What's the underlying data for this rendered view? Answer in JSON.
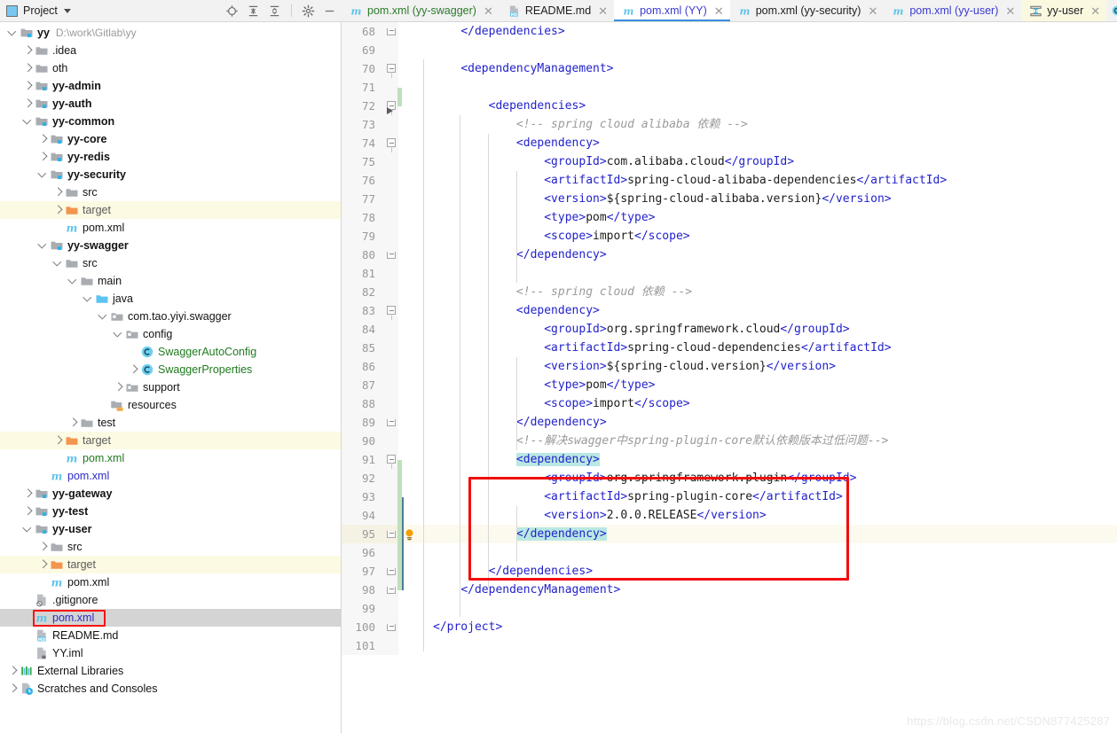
{
  "project_panel": {
    "title": "Project",
    "window_icon": "project-window-icon",
    "caret_icon": "chevron-down-icon",
    "tools": [
      {
        "name": "locate-in-tree-icon",
        "label": "Select Opened File"
      },
      {
        "name": "expand-all-icon",
        "label": "Expand All"
      },
      {
        "name": "collapse-all-icon",
        "label": "Collapse All"
      },
      {
        "name": "gear-icon",
        "label": "Settings"
      },
      {
        "name": "minimize-icon",
        "label": "Hide"
      }
    ],
    "items": [
      {
        "label": "yy",
        "path": "D:\\work\\Gitlab\\yy",
        "icon": "module-folder-icon",
        "indent": 0,
        "arrow": "down",
        "style": "bold-dark"
      },
      {
        "label": ".idea",
        "icon": "folder-icon",
        "indent": 1,
        "arrow": "right",
        "style": "dark"
      },
      {
        "label": "oth",
        "icon": "folder-icon",
        "indent": 1,
        "arrow": "right",
        "style": "dark"
      },
      {
        "label": "yy-admin",
        "icon": "module-folder-icon",
        "indent": 1,
        "arrow": "right",
        "style": "bold-dark"
      },
      {
        "label": "yy-auth",
        "icon": "module-folder-icon",
        "indent": 1,
        "arrow": "right",
        "style": "bold-dark"
      },
      {
        "label": "yy-common",
        "icon": "module-folder-icon",
        "indent": 1,
        "arrow": "down",
        "style": "bold-dark"
      },
      {
        "label": "yy-core",
        "icon": "module-folder-icon",
        "indent": 2,
        "arrow": "right",
        "style": "bold-dark"
      },
      {
        "label": "yy-redis",
        "icon": "module-folder-icon",
        "indent": 2,
        "arrow": "right",
        "style": "bold-dark"
      },
      {
        "label": "yy-security",
        "icon": "module-folder-icon",
        "indent": 2,
        "arrow": "down",
        "style": "bold-dark"
      },
      {
        "label": "src",
        "icon": "folder-icon",
        "indent": 3,
        "arrow": "right",
        "style": "dark"
      },
      {
        "label": "target",
        "icon": "excluded-folder-icon",
        "indent": 3,
        "arrow": "right",
        "style": "gray",
        "row_highlight": true
      },
      {
        "label": "pom.xml",
        "icon": "maven-file-icon",
        "indent": 3,
        "arrow": "none",
        "style": "dark"
      },
      {
        "label": "yy-swagger",
        "icon": "module-folder-icon",
        "indent": 2,
        "arrow": "down",
        "style": "bold-dark"
      },
      {
        "label": "src",
        "icon": "folder-icon",
        "indent": 3,
        "arrow": "down",
        "style": "dark"
      },
      {
        "label": "main",
        "icon": "folder-icon",
        "indent": 4,
        "arrow": "down",
        "style": "dark"
      },
      {
        "label": "java",
        "icon": "source-root-icon",
        "indent": 5,
        "arrow": "down",
        "style": "dark"
      },
      {
        "label": "com.tao.yiyi.swagger",
        "icon": "package-icon",
        "indent": 6,
        "arrow": "down",
        "style": "dark"
      },
      {
        "label": "config",
        "icon": "package-icon",
        "indent": 7,
        "arrow": "down",
        "style": "dark"
      },
      {
        "label": "SwaggerAutoConfig",
        "icon": "java-class-icon",
        "indent": 8,
        "arrow": "none",
        "style": "green"
      },
      {
        "label": "SwaggerProperties",
        "icon": "java-class-icon",
        "indent": 8,
        "arrow": "right",
        "style": "green"
      },
      {
        "label": "support",
        "icon": "package-icon",
        "indent": 7,
        "arrow": "right",
        "style": "dark"
      },
      {
        "label": "resources",
        "icon": "resources-root-icon",
        "indent": 6,
        "arrow": "none",
        "style": "dark"
      },
      {
        "label": "test",
        "icon": "folder-icon",
        "indent": 4,
        "arrow": "right",
        "style": "dark"
      },
      {
        "label": "target",
        "icon": "excluded-folder-icon",
        "indent": 3,
        "arrow": "right",
        "style": "gray",
        "row_highlight": true
      },
      {
        "label": "pom.xml",
        "icon": "maven-file-icon",
        "indent": 3,
        "arrow": "none",
        "style": "green"
      },
      {
        "label": "pom.xml",
        "icon": "maven-file-icon",
        "indent": 2,
        "arrow": "none",
        "style": "blue"
      },
      {
        "label": "yy-gateway",
        "icon": "module-folder-icon",
        "indent": 1,
        "arrow": "right",
        "style": "bold-dark"
      },
      {
        "label": "yy-test",
        "icon": "module-folder-icon",
        "indent": 1,
        "arrow": "right",
        "style": "bold-dark"
      },
      {
        "label": "yy-user",
        "icon": "module-folder-icon",
        "indent": 1,
        "arrow": "down",
        "style": "bold-dark"
      },
      {
        "label": "src",
        "icon": "folder-icon",
        "indent": 2,
        "arrow": "right",
        "style": "dark"
      },
      {
        "label": "target",
        "icon": "excluded-folder-icon",
        "indent": 2,
        "arrow": "right",
        "style": "gray",
        "row_highlight": true
      },
      {
        "label": "pom.xml",
        "icon": "maven-file-icon",
        "indent": 2,
        "arrow": "none",
        "style": "dark"
      },
      {
        "label": ".gitignore",
        "icon": "gitignore-file-icon",
        "indent": 1,
        "arrow": "none",
        "style": "dark"
      },
      {
        "label": "pom.xml",
        "icon": "maven-file-icon",
        "indent": 1,
        "arrow": "none",
        "style": "blue",
        "selected": true,
        "annotated": true
      },
      {
        "label": "README.md",
        "icon": "markdown-file-icon",
        "indent": 1,
        "arrow": "none",
        "style": "dark"
      },
      {
        "label": "YY.iml",
        "icon": "iml-file-icon",
        "indent": 1,
        "arrow": "none",
        "style": "dark"
      },
      {
        "label": "External Libraries",
        "icon": "libraries-icon",
        "indent": 0,
        "arrow": "right",
        "style": "dark"
      },
      {
        "label": "Scratches and Consoles",
        "icon": "scratches-icon",
        "indent": 0,
        "arrow": "right",
        "style": "dark"
      }
    ]
  },
  "editor_tabs": [
    {
      "label": "pom.xml (yy-swagger)",
      "icon": "maven-file-icon",
      "label_color": "green",
      "active": false,
      "highlight": false,
      "close_icon": "close-icon"
    },
    {
      "label": "README.md",
      "icon": "markdown-file-icon",
      "label_color": "dark",
      "active": false,
      "highlight": false,
      "close_icon": "close-icon"
    },
    {
      "label": "pom.xml (YY)",
      "icon": "maven-file-icon",
      "label_color": "blue",
      "active": true,
      "highlight": false,
      "close_icon": "close-icon"
    },
    {
      "label": "pom.xml (yy-security)",
      "icon": "maven-file-icon",
      "label_color": "dark",
      "active": false,
      "highlight": false,
      "close_icon": "close-icon"
    },
    {
      "label": "pom.xml (yy-user)",
      "icon": "maven-file-icon",
      "label_color": "blue",
      "active": false,
      "highlight": false,
      "close_icon": "close-icon"
    },
    {
      "label": "yy-user",
      "icon": "uml-diagram-icon",
      "label_color": "dark",
      "active": false,
      "highlight": true,
      "close_icon": "close-icon"
    }
  ],
  "tabs_right_icon": "class-diagram-icon",
  "editor": {
    "first_line_number": 68,
    "caret_line": 95,
    "bulb_line": 95,
    "run_marker_line": 72,
    "lines": [
      {
        "n": 68,
        "indent": 1,
        "tokens": [
          {
            "t": "tag",
            "v": "</dependencies>"
          }
        ],
        "fold": "end"
      },
      {
        "n": 69,
        "indent": 0,
        "tokens": []
      },
      {
        "n": 70,
        "indent": 1,
        "tokens": [
          {
            "t": "tag",
            "v": "<dependencyManagement>"
          }
        ],
        "fold": "open"
      },
      {
        "n": 71,
        "indent": 0,
        "tokens": []
      },
      {
        "n": 72,
        "indent": 2,
        "tokens": [
          {
            "t": "tag",
            "v": "<dependencies>"
          }
        ],
        "fold": "open"
      },
      {
        "n": 73,
        "indent": 3,
        "tokens": [
          {
            "t": "comment",
            "v": "<!-- spring cloud alibaba 依赖 -->"
          }
        ]
      },
      {
        "n": 74,
        "indent": 3,
        "tokens": [
          {
            "t": "tag",
            "v": "<dependency>"
          }
        ],
        "fold": "open"
      },
      {
        "n": 75,
        "indent": 4,
        "tokens": [
          {
            "t": "tag",
            "v": "<groupId>"
          },
          {
            "t": "text",
            "v": "com.alibaba.cloud"
          },
          {
            "t": "tag",
            "v": "</groupId>"
          }
        ]
      },
      {
        "n": 76,
        "indent": 4,
        "tokens": [
          {
            "t": "tag",
            "v": "<artifactId>"
          },
          {
            "t": "text",
            "v": "spring-cloud-alibaba-dependencies"
          },
          {
            "t": "tag",
            "v": "</artifactId>"
          }
        ]
      },
      {
        "n": 77,
        "indent": 4,
        "tokens": [
          {
            "t": "tag",
            "v": "<version>"
          },
          {
            "t": "text",
            "v": "${spring-cloud-alibaba.version}"
          },
          {
            "t": "tag",
            "v": "</version>"
          }
        ]
      },
      {
        "n": 78,
        "indent": 4,
        "tokens": [
          {
            "t": "tag",
            "v": "<type>"
          },
          {
            "t": "text",
            "v": "pom"
          },
          {
            "t": "tag",
            "v": "</type>"
          }
        ]
      },
      {
        "n": 79,
        "indent": 4,
        "tokens": [
          {
            "t": "tag",
            "v": "<scope>"
          },
          {
            "t": "text",
            "v": "import"
          },
          {
            "t": "tag",
            "v": "</scope>"
          }
        ]
      },
      {
        "n": 80,
        "indent": 3,
        "tokens": [
          {
            "t": "tag",
            "v": "</dependency>"
          }
        ],
        "fold": "end"
      },
      {
        "n": 81,
        "indent": 0,
        "tokens": []
      },
      {
        "n": 82,
        "indent": 3,
        "tokens": [
          {
            "t": "comment",
            "v": "<!-- spring cloud 依赖 -->"
          }
        ]
      },
      {
        "n": 83,
        "indent": 3,
        "tokens": [
          {
            "t": "tag",
            "v": "<dependency>"
          }
        ],
        "fold": "open"
      },
      {
        "n": 84,
        "indent": 4,
        "tokens": [
          {
            "t": "tag",
            "v": "<groupId>"
          },
          {
            "t": "text",
            "v": "org.springframework.cloud"
          },
          {
            "t": "tag",
            "v": "</groupId>"
          }
        ]
      },
      {
        "n": 85,
        "indent": 4,
        "tokens": [
          {
            "t": "tag",
            "v": "<artifactId>"
          },
          {
            "t": "text",
            "v": "spring-cloud-dependencies"
          },
          {
            "t": "tag",
            "v": "</artifactId>"
          }
        ]
      },
      {
        "n": 86,
        "indent": 4,
        "tokens": [
          {
            "t": "tag",
            "v": "<version>"
          },
          {
            "t": "text",
            "v": "${spring-cloud.version}"
          },
          {
            "t": "tag",
            "v": "</version>"
          }
        ]
      },
      {
        "n": 87,
        "indent": 4,
        "tokens": [
          {
            "t": "tag",
            "v": "<type>"
          },
          {
            "t": "text",
            "v": "pom"
          },
          {
            "t": "tag",
            "v": "</type>"
          }
        ]
      },
      {
        "n": 88,
        "indent": 4,
        "tokens": [
          {
            "t": "tag",
            "v": "<scope>"
          },
          {
            "t": "text",
            "v": "import"
          },
          {
            "t": "tag",
            "v": "</scope>"
          }
        ]
      },
      {
        "n": 89,
        "indent": 3,
        "tokens": [
          {
            "t": "tag",
            "v": "</dependency>"
          }
        ],
        "fold": "end"
      },
      {
        "n": 90,
        "indent": 3,
        "tokens": [
          {
            "t": "comment",
            "v": "<!--解决swagger中spring-plugin-core默认依赖版本过低问题-->"
          }
        ]
      },
      {
        "n": 91,
        "indent": 3,
        "tokens": [
          {
            "t": "tag-hl",
            "v": "<dependency>"
          }
        ],
        "fold": "open"
      },
      {
        "n": 92,
        "indent": 4,
        "tokens": [
          {
            "t": "tag",
            "v": "<groupId>"
          },
          {
            "t": "text",
            "v": "org.springframework.plugin"
          },
          {
            "t": "tag",
            "v": "</groupId>"
          }
        ]
      },
      {
        "n": 93,
        "indent": 4,
        "tokens": [
          {
            "t": "tag",
            "v": "<artifactId>"
          },
          {
            "t": "text",
            "v": "spring-plugin-core"
          },
          {
            "t": "tag",
            "v": "</artifactId>"
          }
        ]
      },
      {
        "n": 94,
        "indent": 4,
        "tokens": [
          {
            "t": "tag",
            "v": "<version>"
          },
          {
            "t": "text",
            "v": "2.0.0.RELEASE"
          },
          {
            "t": "tag",
            "v": "</version>"
          }
        ]
      },
      {
        "n": 95,
        "indent": 3,
        "tokens": [
          {
            "t": "tag-hl",
            "v": "</dependency>"
          }
        ],
        "fold": "end",
        "caret": true
      },
      {
        "n": 96,
        "indent": 0,
        "tokens": []
      },
      {
        "n": 97,
        "indent": 2,
        "tokens": [
          {
            "t": "tag",
            "v": "</dependencies>"
          }
        ],
        "fold": "end"
      },
      {
        "n": 98,
        "indent": 1,
        "tokens": [
          {
            "t": "tag",
            "v": "</dependencyManagement>"
          }
        ],
        "fold": "end"
      },
      {
        "n": 99,
        "indent": 0,
        "tokens": []
      },
      {
        "n": 100,
        "indent": 0,
        "tokens": [
          {
            "t": "tag",
            "v": "</project>"
          }
        ],
        "fold": "end"
      },
      {
        "n": 101,
        "indent": 0,
        "tokens": []
      }
    ]
  },
  "annotations": {
    "code_rect_label": "highlighted-dependency-block",
    "tree_rect_label": "highlighted-root-pom"
  },
  "watermark": "https://blog.csdn.net/CSDN877425287",
  "colors": {
    "accent": "#3b8ddd",
    "tag": "#2222cc",
    "comment": "#9a9a9a",
    "annotation_red": "#f20d0d",
    "match_highlight": "#b9e8e3",
    "row_highlight": "#fcfae2",
    "selection": "#d4d4d4",
    "change_bar": "#bfe0bd"
  }
}
